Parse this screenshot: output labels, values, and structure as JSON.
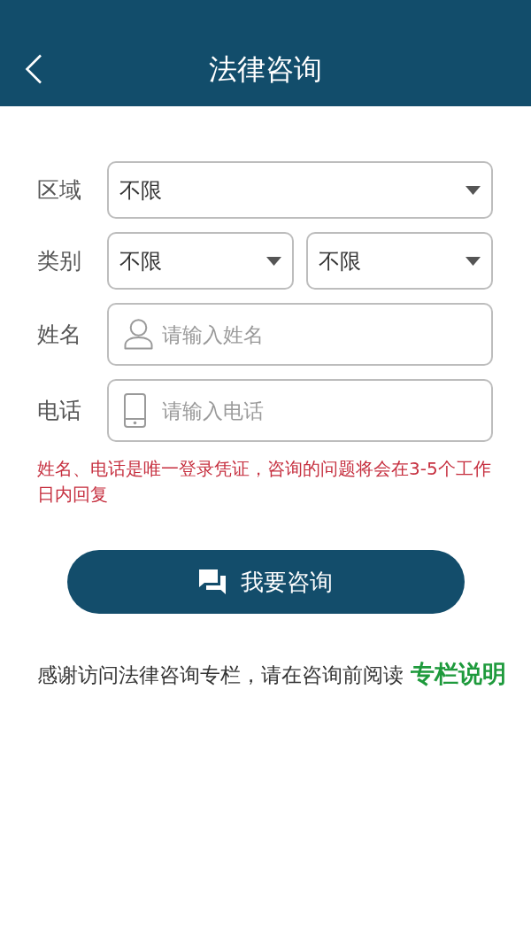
{
  "header": {
    "title": "法律咨询"
  },
  "form": [
    {
      "kind": "dropdown",
      "label": "区域",
      "values": [
        "不限"
      ]
    },
    {
      "kind": "dropdown",
      "label": "类别",
      "values": [
        "不限",
        "不限"
      ]
    },
    {
      "kind": "namefield",
      "label": "姓名",
      "placeholder": "请输入姓名"
    },
    {
      "kind": "phonefield",
      "label": "电话",
      "placeholder": "请输入电话"
    }
  ],
  "notice": "姓名、电话是唯一登录凭证，咨询的问题将会在3-5个工作日内回复",
  "submit_button": {
    "label": "我要咨询"
  },
  "footer": {
    "text": "感谢访问法律咨询专栏，请在咨询前阅读",
    "link": "专栏说明"
  }
}
